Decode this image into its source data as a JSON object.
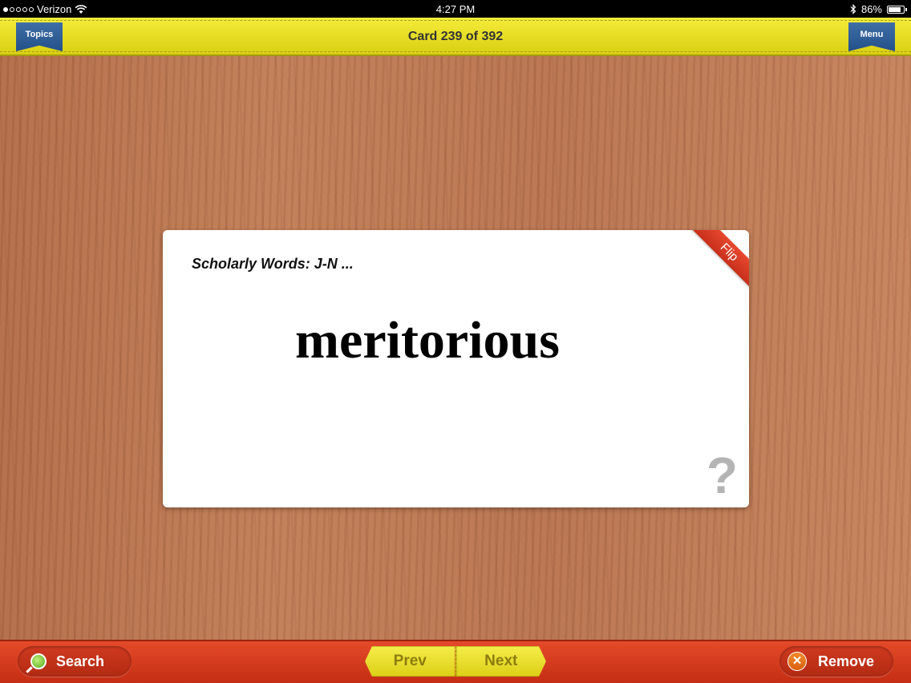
{
  "status_bar": {
    "carrier": "Verizon",
    "time": "4:27 PM",
    "battery": "86%",
    "battery_level": 0.86,
    "signal_bars": 1,
    "icons": [
      "wifi-icon",
      "bluetooth-icon",
      "battery-icon"
    ]
  },
  "top_bar": {
    "topics_label": "Topics",
    "counter": "Card 239 of 392",
    "menu_label": "Menu"
  },
  "card": {
    "topic": "Scholarly Words: J-N ...",
    "word": "meritorious",
    "flip_label": "Flip",
    "help_glyph": "?"
  },
  "bottom_bar": {
    "search_label": "Search",
    "prev_label": "Prev",
    "next_label": "Next",
    "remove_label": "Remove",
    "remove_glyph": "✕"
  },
  "colors": {
    "top_bar": "#e8df24",
    "bottom_bar": "#d43c1f",
    "ribbon": "#2f5f98",
    "flip_band": "#d73a22"
  }
}
